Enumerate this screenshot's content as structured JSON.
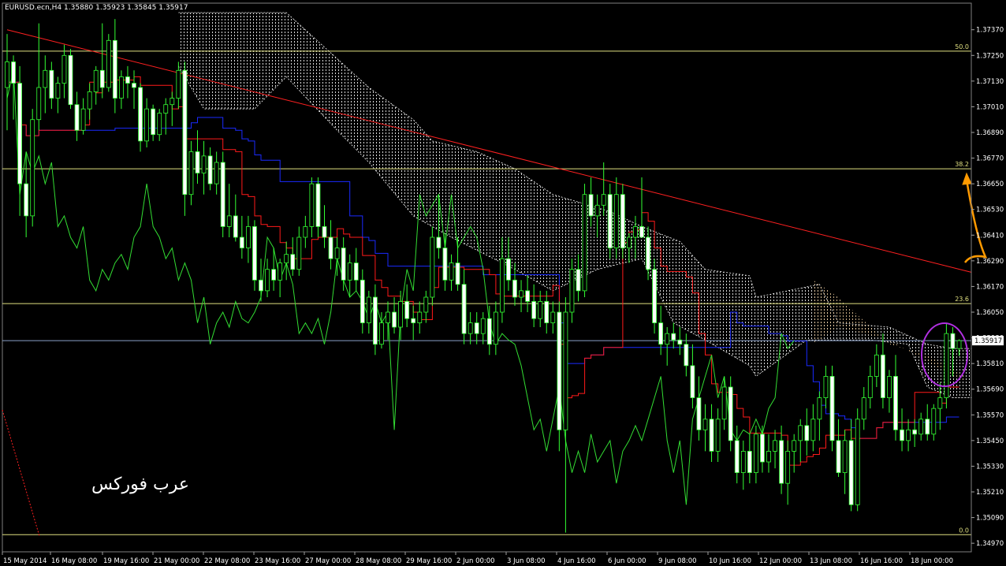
{
  "chart_data": {
    "type": "candlestick",
    "symbol_header": "EURUSD.ecn,H4  1.35880 1.35923 1.35845 1.35917",
    "current_price_label": "1.35917",
    "watermark": "عرب فوركس",
    "ylim": [
      1.3493,
      1.3745
    ],
    "y_ticks": [
      "1.37370",
      "1.37250",
      "1.37130",
      "1.37010",
      "1.36890",
      "1.36770",
      "1.36650",
      "1.36530",
      "1.36410",
      "1.36290",
      "1.36170",
      "1.36050",
      "1.35930",
      "1.35810",
      "1.35690",
      "1.35570",
      "1.35450",
      "1.35330",
      "1.35210",
      "1.35090",
      "1.34970"
    ],
    "x_ticks": [
      "15 May 2014",
      "16 May 08:00",
      "19 May 16:00",
      "21 May 00:00",
      "22 May 08:00",
      "23 May 16:00",
      "27 May 00:00",
      "28 May 08:00",
      "29 May 16:00",
      "2 Jun 00:00",
      "3 Jun 08:00",
      "4 Jun 16:00",
      "6 Jun 00:00",
      "9 Jun 08:00",
      "10 Jun 16:00",
      "12 Jun 00:00",
      "13 Jun 08:00",
      "16 Jun 16:00",
      "18 Jun 00:00"
    ],
    "fibonacci_levels": [
      {
        "label": "50.0",
        "price": 1.3727
      },
      {
        "label": "38.2",
        "price": 1.3672
      },
      {
        "label": "23.6",
        "price": 1.3609
      },
      {
        "label": "0.0",
        "price": 1.3501
      }
    ],
    "current_price_line": 1.35917,
    "trendline": {
      "from_bar": 0,
      "from_price": 1.3737,
      "to_bar": 150,
      "to_price": 1.36225
    },
    "candles": [
      [
        1.371,
        1.3735,
        1.369,
        1.3722
      ],
      [
        1.3722,
        1.3725,
        1.3695,
        1.3712
      ],
      [
        1.3712,
        1.372,
        1.365,
        1.3665
      ],
      [
        1.3665,
        1.368,
        1.364,
        1.365
      ],
      [
        1.365,
        1.37,
        1.3645,
        1.3695
      ],
      [
        1.3695,
        1.374,
        1.369,
        1.371
      ],
      [
        1.371,
        1.3725,
        1.3698,
        1.3718
      ],
      [
        1.3718,
        1.3722,
        1.37,
        1.3705
      ],
      [
        1.3705,
        1.3715,
        1.3698,
        1.3712
      ],
      [
        1.3712,
        1.373,
        1.3705,
        1.3725
      ],
      [
        1.3725,
        1.3728,
        1.37,
        1.3702
      ],
      [
        1.3702,
        1.3708,
        1.3685,
        1.369
      ],
      [
        1.369,
        1.3705,
        1.3688,
        1.37
      ],
      [
        1.37,
        1.3712,
        1.3695,
        1.3708
      ],
      [
        1.3708,
        1.372,
        1.3702,
        1.3718
      ],
      [
        1.3718,
        1.374,
        1.3705,
        1.371
      ],
      [
        1.371,
        1.3735,
        1.3708,
        1.3732
      ],
      [
        1.3732,
        1.3742,
        1.3698,
        1.3705
      ],
      [
        1.3705,
        1.3718,
        1.37,
        1.3715
      ],
      [
        1.3715,
        1.372,
        1.3705,
        1.3712
      ],
      [
        1.3712,
        1.3718,
        1.37,
        1.371
      ],
      [
        1.371,
        1.3712,
        1.368,
        1.3685
      ],
      [
        1.3685,
        1.3705,
        1.3682,
        1.37
      ],
      [
        1.37,
        1.3702,
        1.3685,
        1.3688
      ],
      [
        1.3688,
        1.37,
        1.3685,
        1.3698
      ],
      [
        1.3698,
        1.3705,
        1.3688,
        1.3702
      ],
      [
        1.3702,
        1.3708,
        1.3692,
        1.3705
      ],
      [
        1.3705,
        1.3722,
        1.37,
        1.3718
      ],
      [
        1.3718,
        1.3722,
        1.365,
        1.366
      ],
      [
        1.366,
        1.3685,
        1.3655,
        1.368
      ],
      [
        1.368,
        1.369,
        1.3665,
        1.367
      ],
      [
        1.367,
        1.3685,
        1.366,
        1.3678
      ],
      [
        1.3678,
        1.3682,
        1.3662,
        1.3665
      ],
      [
        1.3665,
        1.368,
        1.366,
        1.3675
      ],
      [
        1.3675,
        1.368,
        1.364,
        1.3645
      ],
      [
        1.3645,
        1.3665,
        1.364,
        1.365
      ],
      [
        1.365,
        1.366,
        1.3638,
        1.364
      ],
      [
        1.364,
        1.365,
        1.363,
        1.3635
      ],
      [
        1.3635,
        1.365,
        1.3628,
        1.3645
      ],
      [
        1.3645,
        1.3648,
        1.3615,
        1.362
      ],
      [
        1.362,
        1.363,
        1.361,
        1.3615
      ],
      [
        1.3615,
        1.363,
        1.3612,
        1.3625
      ],
      [
        1.3625,
        1.3635,
        1.3615,
        1.362
      ],
      [
        1.362,
        1.363,
        1.3612,
        1.3628
      ],
      [
        1.3628,
        1.3638,
        1.362,
        1.3632
      ],
      [
        1.3632,
        1.364,
        1.3622,
        1.3625
      ],
      [
        1.3625,
        1.3645,
        1.3622,
        1.364
      ],
      [
        1.364,
        1.365,
        1.3635,
        1.3645
      ],
      [
        1.3645,
        1.3668,
        1.364,
        1.3665
      ],
      [
        1.3665,
        1.3668,
        1.364,
        1.3645
      ],
      [
        1.3645,
        1.3655,
        1.3635,
        1.364
      ],
      [
        1.364,
        1.3648,
        1.3625,
        1.363
      ],
      [
        1.363,
        1.364,
        1.3622,
        1.3635
      ],
      [
        1.3635,
        1.364,
        1.3615,
        1.362
      ],
      [
        1.362,
        1.3632,
        1.3612,
        1.3628
      ],
      [
        1.3628,
        1.3635,
        1.3615,
        1.362
      ],
      [
        1.362,
        1.3625,
        1.3595,
        1.36
      ],
      [
        1.36,
        1.3615,
        1.3595,
        1.3612
      ],
      [
        1.3612,
        1.3618,
        1.3585,
        1.359
      ],
      [
        1.359,
        1.3605,
        1.3588,
        1.36
      ],
      [
        1.36,
        1.361,
        1.3592,
        1.3605
      ],
      [
        1.3605,
        1.3612,
        1.3595,
        1.3598
      ],
      [
        1.3598,
        1.3615,
        1.3592,
        1.361
      ],
      [
        1.361,
        1.3618,
        1.3598,
        1.3602
      ],
      [
        1.3602,
        1.3608,
        1.3592,
        1.36
      ],
      [
        1.36,
        1.361,
        1.3595,
        1.3605
      ],
      [
        1.3605,
        1.3615,
        1.36,
        1.3612
      ],
      [
        1.3612,
        1.3645,
        1.3608,
        1.364
      ],
      [
        1.364,
        1.366,
        1.363,
        1.3635
      ],
      [
        1.3635,
        1.3642,
        1.3615,
        1.362
      ],
      [
        1.362,
        1.3632,
        1.3615,
        1.3628
      ],
      [
        1.3628,
        1.364,
        1.3615,
        1.3618
      ],
      [
        1.3618,
        1.3625,
        1.359,
        1.3595
      ],
      [
        1.3595,
        1.3605,
        1.359,
        1.36
      ],
      [
        1.36,
        1.3605,
        1.359,
        1.3595
      ],
      [
        1.3595,
        1.3605,
        1.359,
        1.3602
      ],
      [
        1.3602,
        1.3608,
        1.3585,
        1.359
      ],
      [
        1.359,
        1.361,
        1.3585,
        1.3605
      ],
      [
        1.3605,
        1.364,
        1.36,
        1.363
      ],
      [
        1.363,
        1.364,
        1.3615,
        1.362
      ],
      [
        1.362,
        1.3628,
        1.3608,
        1.3612
      ],
      [
        1.3612,
        1.362,
        1.3605,
        1.3615
      ],
      [
        1.3615,
        1.3622,
        1.3605,
        1.361
      ],
      [
        1.361,
        1.3618,
        1.3598,
        1.3602
      ],
      [
        1.3602,
        1.3615,
        1.3598,
        1.361
      ],
      [
        1.361,
        1.3615,
        1.3595,
        1.36
      ],
      [
        1.36,
        1.361,
        1.3595,
        1.3605
      ],
      [
        1.3605,
        1.361,
        1.354,
        1.355
      ],
      [
        1.355,
        1.3612,
        1.3502,
        1.3605
      ],
      [
        1.3605,
        1.363,
        1.36,
        1.3625
      ],
      [
        1.3625,
        1.3632,
        1.361,
        1.3615
      ],
      [
        1.3615,
        1.3665,
        1.3612,
        1.366
      ],
      [
        1.366,
        1.3668,
        1.3645,
        1.365
      ],
      [
        1.365,
        1.366,
        1.364,
        1.3655
      ],
      [
        1.3655,
        1.3675,
        1.365,
        1.366
      ],
      [
        1.366,
        1.3665,
        1.363,
        1.3635
      ],
      [
        1.3635,
        1.3668,
        1.363,
        1.366
      ],
      [
        1.366,
        1.3665,
        1.363,
        1.3635
      ],
      [
        1.3635,
        1.3642,
        1.3628,
        1.364
      ],
      [
        1.364,
        1.365,
        1.363,
        1.3645
      ],
      [
        1.3645,
        1.3668,
        1.364,
        1.364
      ],
      [
        1.364,
        1.3645,
        1.362,
        1.3625
      ],
      [
        1.3625,
        1.363,
        1.3595,
        1.36
      ],
      [
        1.36,
        1.3608,
        1.3585,
        1.359
      ],
      [
        1.359,
        1.3598,
        1.358,
        1.3595
      ],
      [
        1.3595,
        1.36,
        1.3588,
        1.3592
      ],
      [
        1.3592,
        1.3598,
        1.3585,
        1.359
      ],
      [
        1.359,
        1.3595,
        1.3575,
        1.358
      ],
      [
        1.358,
        1.359,
        1.356,
        1.3565
      ],
      [
        1.3565,
        1.3575,
        1.3545,
        1.355
      ],
      [
        1.355,
        1.3562,
        1.354,
        1.3555
      ],
      [
        1.3555,
        1.3562,
        1.3535,
        1.354
      ],
      [
        1.354,
        1.356,
        1.3535,
        1.3555
      ],
      [
        1.3555,
        1.3575,
        1.355,
        1.357
      ],
      [
        1.357,
        1.3575,
        1.354,
        1.3545
      ],
      [
        1.3545,
        1.3552,
        1.3525,
        1.353
      ],
      [
        1.353,
        1.3545,
        1.3522,
        1.354
      ],
      [
        1.354,
        1.3548,
        1.3525,
        1.353
      ],
      [
        1.353,
        1.3552,
        1.3525,
        1.3548
      ],
      [
        1.3548,
        1.3552,
        1.353,
        1.3535
      ],
      [
        1.3535,
        1.3548,
        1.353,
        1.354
      ],
      [
        1.354,
        1.355,
        1.3532,
        1.3545
      ],
      [
        1.3545,
        1.3552,
        1.352,
        1.3525
      ],
      [
        1.3525,
        1.3545,
        1.3515,
        1.354
      ],
      [
        1.354,
        1.3548,
        1.353,
        1.3545
      ],
      [
        1.3545,
        1.3555,
        1.3535,
        1.3552
      ],
      [
        1.3552,
        1.356,
        1.3538,
        1.3545
      ],
      [
        1.3545,
        1.3562,
        1.354,
        1.3555
      ],
      [
        1.3555,
        1.3568,
        1.3545,
        1.3565
      ],
      [
        1.3565,
        1.358,
        1.356,
        1.3575
      ],
      [
        1.3575,
        1.358,
        1.354,
        1.3545
      ],
      [
        1.3545,
        1.3555,
        1.3528,
        1.353
      ],
      [
        1.353,
        1.355,
        1.352,
        1.3545
      ],
      [
        1.3545,
        1.3555,
        1.3512,
        1.3515
      ],
      [
        1.3515,
        1.356,
        1.3512,
        1.3555
      ],
      [
        1.3555,
        1.357,
        1.355,
        1.3565
      ],
      [
        1.3565,
        1.358,
        1.356,
        1.3575
      ],
      [
        1.3575,
        1.359,
        1.357,
        1.3585
      ],
      [
        1.3585,
        1.3595,
        1.356,
        1.3565
      ],
      [
        1.3565,
        1.3578,
        1.3558,
        1.3575
      ],
      [
        1.3575,
        1.3585,
        1.3545,
        1.355
      ],
      [
        1.355,
        1.356,
        1.354,
        1.3545
      ],
      [
        1.3545,
        1.3555,
        1.354,
        1.355
      ],
      [
        1.355,
        1.3555,
        1.3542,
        1.3548
      ],
      [
        1.3548,
        1.3558,
        1.3545,
        1.3555
      ],
      [
        1.3555,
        1.3562,
        1.3545,
        1.3548
      ],
      [
        1.3548,
        1.3562,
        1.3545,
        1.356
      ],
      [
        1.356,
        1.3572,
        1.355,
        1.3565
      ],
      [
        1.3565,
        1.36,
        1.356,
        1.3595
      ],
      [
        1.3595,
        1.3598,
        1.3575,
        1.3588
      ],
      [
        1.3588,
        1.35923,
        1.35845,
        1.35917
      ]
    ]
  }
}
